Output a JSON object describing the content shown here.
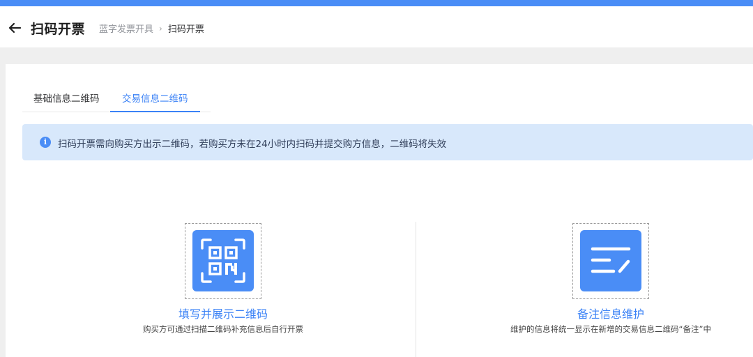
{
  "header": {
    "title": "扫码开票",
    "breadcrumb": [
      {
        "label": "蓝字发票开具"
      },
      {
        "label": "扫码开票"
      }
    ]
  },
  "tabs": [
    {
      "label": "基础信息二维码",
      "active": false
    },
    {
      "label": "交易信息二维码",
      "active": true
    }
  ],
  "notice": {
    "icon": "info-icon",
    "text": "扫码开票需向购买方出示二维码，若购买方未在24小时内扫码并提交购方信息，二维码将失效"
  },
  "options": [
    {
      "icon": "qr-code-icon",
      "title": "填写并展示二维码",
      "description": "购买方可通过扫描二维码补充信息后自行开票"
    },
    {
      "icon": "note-edit-icon",
      "title": "备注信息维护",
      "description": "维护的信息将统一显示在新增的交易信息二维码“备注”中"
    }
  ],
  "colors": {
    "accent": "#3b82f6",
    "topbar": "#4a8df6",
    "notice_bg": "#d8e8fb"
  }
}
